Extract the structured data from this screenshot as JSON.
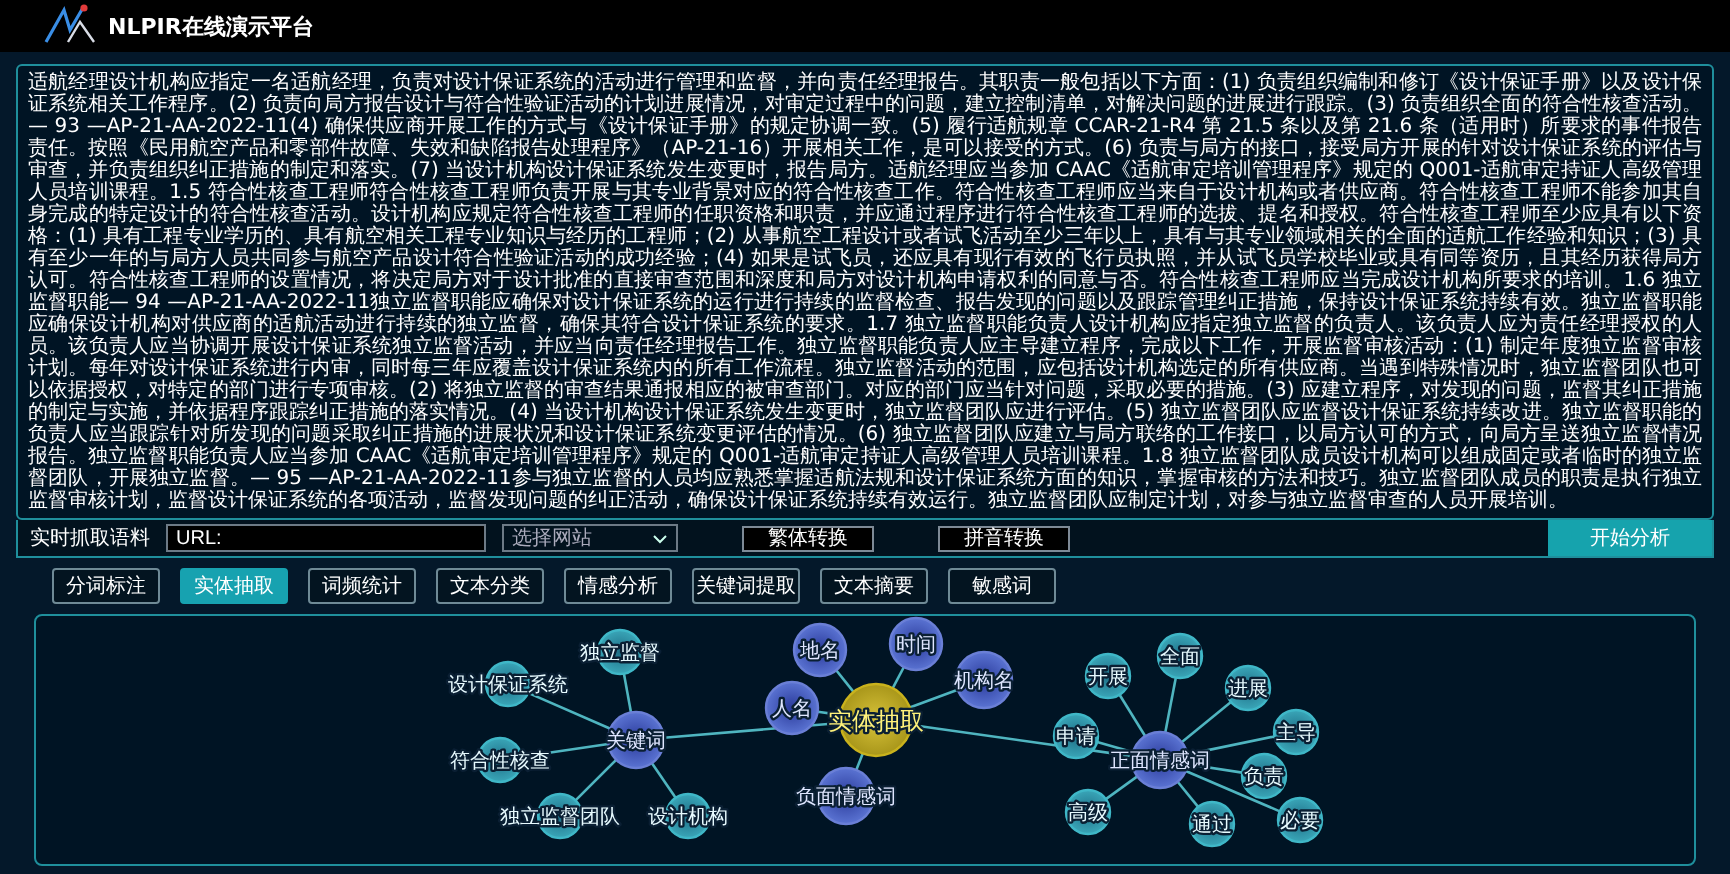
{
  "header": {
    "title": "NLPIR在线演示平台"
  },
  "text_area": {
    "value": "适航经理设计机构应指定一名适航经理，负责对设计保证系统的活动进行管理和监督，并向责任经理报告。其职责一般包括以下方面：(1) 负责组织编制和修订《设计保证手册》以及设计保证系统相关工作程序。(2) 负责向局方报告设计与符合性验证活动的计划进展情况，对审定过程中的问题，建立控制清单，对解决问题的进展进行跟踪。(3) 负责组织全面的符合性核查活动。— 93 —AP-21-AA-2022-11(4) 确保供应商开展工作的方式与《设计保证手册》的规定协调一致。(5) 履行适航规章 CCAR-21-R4 第 21.5 条以及第 21.6 条（适用时）所要求的事件报告责任。按照《民用航空产品和零部件故障、失效和缺陷报告处理程序》（AP-21-16）开展相关工作，是可以接受的方式。(6) 负责与局方的接口，接受局方开展的针对设计保证系统的评估与审查，并负责组织纠正措施的制定和落实。(7) 当设计机构设计保证系统发生变更时，报告局方。适航经理应当参加 CAAC《适航审定培训管理程序》规定的 Q001-适航审定持证人高级管理人员培训课程。1.5 符合性核查工程师符合性核查工程师负责开展与其专业背景对应的符合性核查工作。符合性核查工程师应当来自于设计机构或者供应商。符合性核查工程师不能参加其自身完成的特定设计的符合性核查活动。设计机构应规定符合性核查工程师的任职资格和职责，并应通过程序进行符合性核查工程师的选拔、提名和授权。符合性核查工程师至少应具有以下资格：(1) 具有工程专业学历的、具有航空相关工程专业知识与经历的工程师；(2) 从事航空工程设计或者试飞活动至少三年以上，具有与其专业领域相关的全面的适航工作经验和知识；(3) 具有至少一年的与局方人员共同参与航空产品设计符合性验证活动的成功经验；(4) 如果是试飞员，还应具有现行有效的飞行员执照，并从试飞员学校毕业或具有同等资历，且其经历获得局方认可。符合性核查工程师的设置情况，将决定局方对于设计批准的直接审查范围和深度和局方对设计机构申请权利的同意与否。符合性核查工程师应当完成设计机构所要求的培训。1.6 独立监督职能— 94 —AP-21-AA-2022-11独立监督职能应确保对设计保证系统的运行进行持续的监督检查、报告发现的问题以及跟踪管理纠正措施，保持设计保证系统持续有效。独立监督职能应确保设计机构对供应商的适航活动进行持续的独立监督，确保其符合设计保证系统的要求。1.7 独立监督职能负责人设计机构应指定独立监督的负责人。该负责人应为责任经理授权的人员。该负责人应当协调开展设计保证系统独立监督活动，并应当向责任经理报告工作。独立监督职能负责人应主导建立程序，完成以下工作，开展监督审核活动：(1) 制定年度独立监督审核计划。每年对设计保证系统进行内审，同时每三年应覆盖设计保证系统内的所有工作流程。独立监督活动的范围，应包括设计机构选定的所有供应商。当遇到特殊情况时，独立监督团队也可以依据授权，对特定的部门进行专项审核。(2) 将独立监督的审查结果通报相应的被审查部门。对应的部门应当针对问题，采取必要的措施。(3) 应建立程序，对发现的问题，监督其纠正措施的制定与实施，并依据程序跟踪纠正措施的落实情况。(4) 当设计机构设计保证系统发生变更时，独立监督团队应进行评估。(5) 独立监督团队应监督设计保证系统持续改进。独立监督职能的负责人应当跟踪针对所发现的问题采取纠正措施的进展状况和设计保证系统变更评估的情况。(6) 独立监督团队应建立与局方联络的工作接口，以局方认可的方式，向局方呈送独立监督情况报告。独立监督职能负责人应当参加 CAAC《适航审定培训管理程序》规定的 Q001-适航审定持证人高级管理人员培训课程。1.8 独立监督团队成员设计机构可以组成固定或者临时的独立监督团队，开展独立监督。— 95 —AP-21-AA-2022-11参与独立监督的人员均应熟悉掌握适航法规和设计保证系统方面的知识，掌握审核的方法和技巧。独立监督团队成员的职责是执行独立监督审核计划，监督设计保证系统的各项活动，监督发现问题的纠正活动，确保设计保证系统持续有效运行。独立监督团队应制定计划，对参与独立监督审查的人员开展培训。"
  },
  "toolbar": {
    "label": "实时抓取语料",
    "url_field": {
      "placeholder": "URL:"
    },
    "site_select": {
      "value": "选择网站"
    },
    "buttons": [
      "繁体转换",
      "拼音转换"
    ],
    "analyze_button": "开始分析"
  },
  "tabs": [
    {
      "label": "分词标注",
      "selected": false
    },
    {
      "label": "实体抽取",
      "selected": true
    },
    {
      "label": "词频统计",
      "selected": false
    },
    {
      "label": "文本分类",
      "selected": false
    },
    {
      "label": "情感分析",
      "selected": false
    },
    {
      "label": "关键词提取",
      "selected": false
    },
    {
      "label": "文本摘要",
      "selected": false
    },
    {
      "label": "敏感词",
      "selected": false
    }
  ],
  "graph": {
    "label": "实体抽取",
    "children": [
      {
        "label": "人名"
      },
      {
        "label": "地名"
      },
      {
        "label": "时间"
      },
      {
        "label": "机构名"
      },
      {
        "label": "负面情感词"
      },
      {
        "label": "关键词",
        "children": [
          {
            "label": "独立监督"
          },
          {
            "label": "设计保证系统"
          },
          {
            "label": "符合性核查"
          },
          {
            "label": "独立监督团队"
          },
          {
            "label": "设计机构"
          }
        ]
      },
      {
        "label": "正面情感词",
        "children": [
          {
            "label": "申请"
          },
          {
            "label": "开展"
          },
          {
            "label": "全面"
          },
          {
            "label": "进展"
          },
          {
            "label": "主导"
          },
          {
            "label": "负责"
          },
          {
            "label": "通过"
          },
          {
            "label": "必要"
          },
          {
            "label": "高级"
          }
        ]
      }
    ]
  }
}
